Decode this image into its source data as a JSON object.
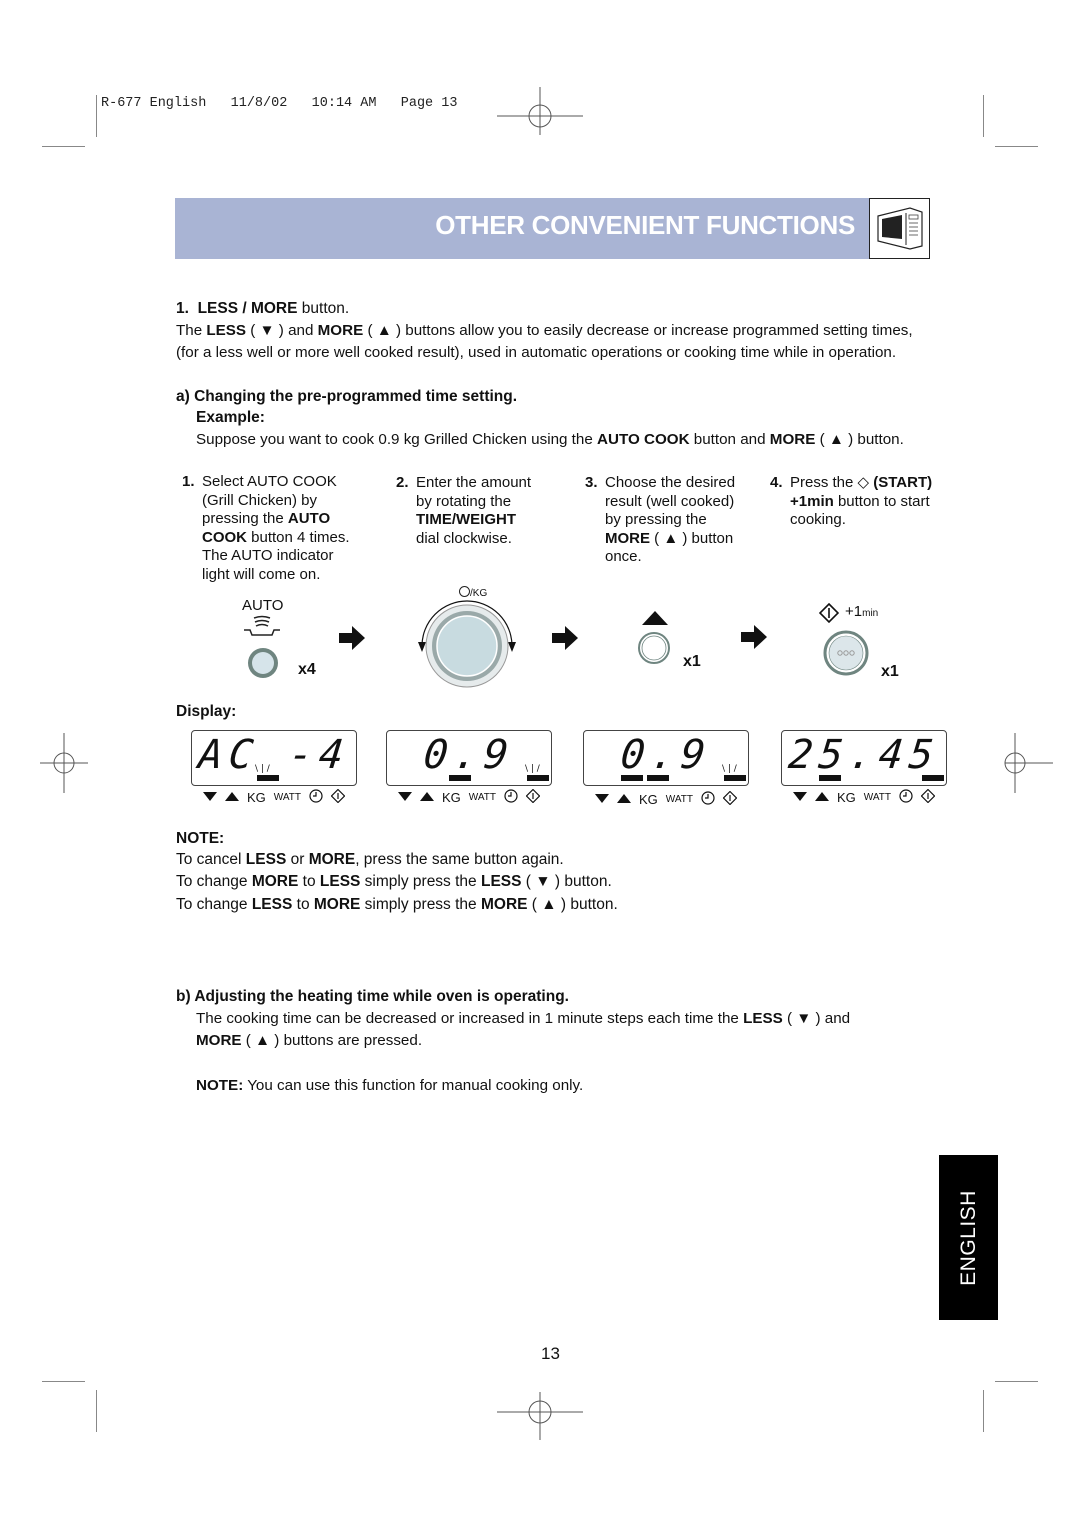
{
  "printer_header": "R-677 English   11/8/02   10:14 AM   Page 13",
  "banner": {
    "title": "OTHER CONVENIENT FUNCTIONS",
    "icon": "microwave-icon",
    "color": "#a9b4d4"
  },
  "section1": {
    "heading_num": "1.",
    "heading_bold": "LESS / MORE",
    "heading_rest": " button.",
    "line1_a": "The ",
    "line1_less": "LESS",
    "line1_b": " ( ▼ ) and ",
    "line1_more": "MORE",
    "line1_c": " ( ▲ ) buttons allow you to easily decrease or increase programmed setting times,",
    "line2": "(for a less well or more well cooked result), used in automatic operations or cooking time while in operation."
  },
  "sub_a": {
    "heading": "a) Changing the pre-programmed time setting.",
    "example_label": "Example:",
    "example_a": "Suppose you want to cook 0.9 kg Grilled Chicken using the ",
    "example_auto": "AUTO COOK",
    "example_b": " button and ",
    "example_more": "MORE",
    "example_c": " ( ▲ ) button."
  },
  "steps": [
    {
      "num": "1.",
      "lines": [
        "Select AUTO COOK",
        "(Grill Chicken) by",
        "pressing the |AUTO|",
        "|COOK| button 4 times.",
        "The AUTO indicator",
        "light will come on."
      ]
    },
    {
      "num": "2.",
      "lines": [
        "Enter the amount",
        "by rotating the",
        "|TIME/WEIGHT|",
        "dial clockwise."
      ]
    },
    {
      "num": "3.",
      "lines": [
        "Choose the desired",
        "result (well cooked)",
        "by pressing the",
        "|MORE| ( ▲ ) button",
        "once."
      ]
    },
    {
      "num": "4.",
      "lines": [
        "Press the  ◇ |(START)|",
        "|+1min| button to start",
        "cooking."
      ]
    }
  ],
  "illustrations": {
    "auto_label": "AUTO",
    "auto_count": "x4",
    "dial_label": "/KG",
    "more_count": "x1",
    "start_label": "+1",
    "start_label_small": "min",
    "start_count": "x1"
  },
  "display": {
    "label": "Display:",
    "panels": [
      {
        "digits": "AC -4",
        "indicator_labels": [
          "▼",
          "▲",
          "KG",
          "WATT",
          "clock",
          "start"
        ]
      },
      {
        "digits": "0.9",
        "indicator_labels": [
          "▼",
          "▲",
          "KG",
          "WATT",
          "clock",
          "start"
        ]
      },
      {
        "digits": "0.9",
        "indicator_labels": [
          "▼",
          "▲",
          "KG",
          "WATT",
          "clock",
          "start"
        ]
      },
      {
        "digits": "25.45",
        "indicator_labels": [
          "▼",
          "▲",
          "KG",
          "WATT",
          "clock",
          "start"
        ]
      }
    ],
    "kg": "KG",
    "watt": "WATT"
  },
  "note1": {
    "label": "NOTE:",
    "l1": [
      "To cancel ",
      "LESS",
      " or ",
      "MORE",
      ", press the same button again."
    ],
    "l2": [
      "To change ",
      "MORE",
      " to ",
      "LESS",
      " simply press the ",
      "LESS",
      " ( ▼ ) button."
    ],
    "l3": [
      "To change ",
      "LESS",
      " to ",
      "MORE",
      " simply press the ",
      "MORE",
      " ( ▲ ) button."
    ]
  },
  "sub_b": {
    "heading": "b) Adjusting the heating time while oven is operating.",
    "l1_a": "The cooking time can be decreased or increased in 1 minute steps each time the ",
    "l1_less": "LESS",
    "l1_b": " ( ▼ ) and",
    "l2_more": "MORE",
    "l2_b": " ( ▲ ) buttons are pressed.",
    "note_label": "NOTE:",
    "note_text": "  You can use this function for manual cooking only."
  },
  "side_tab": "ENGLISH",
  "page_number": "13"
}
